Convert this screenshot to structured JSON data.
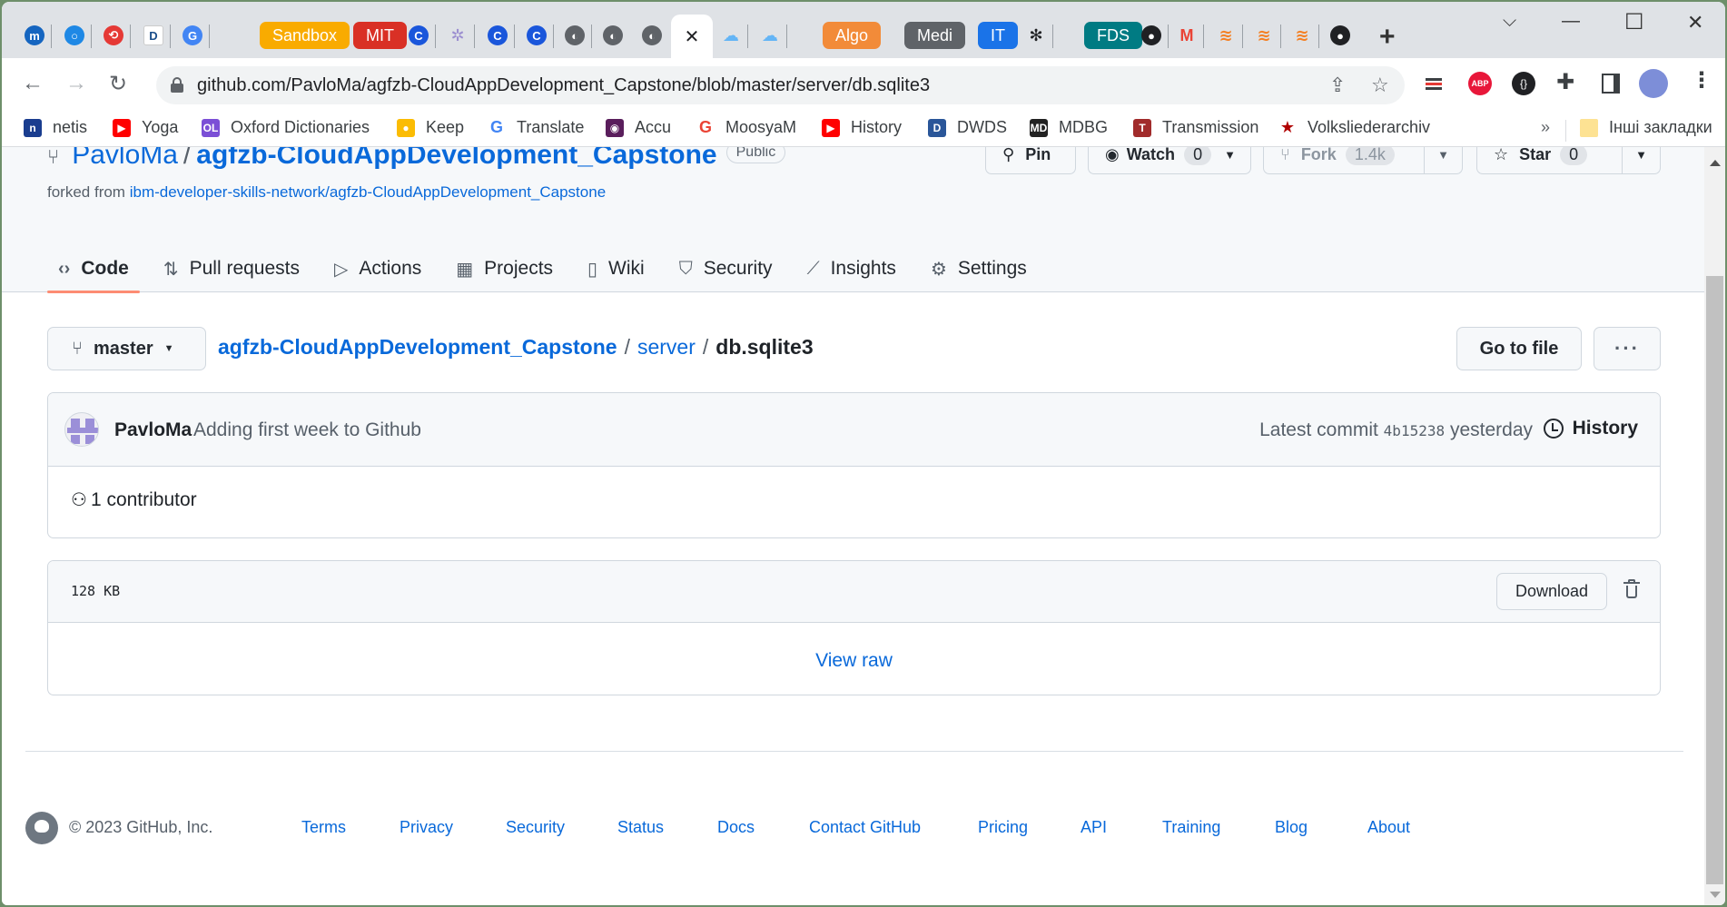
{
  "browser": {
    "tabs": [
      {
        "label": "",
        "icon": "m-logo-icon",
        "color": "#1565c0"
      },
      {
        "label": "",
        "icon": "o-ring-icon",
        "color": "#1e88e5"
      },
      {
        "label": "",
        "icon": "sync-arrows-icon",
        "color": "#e53935"
      },
      {
        "label": "",
        "icon": "d-letter-icon",
        "color": "#1a4e8a"
      },
      {
        "label": "",
        "icon": "google-translate-icon",
        "color": "#4285f4"
      },
      {
        "label": "Sandbox",
        "icon": "",
        "color": "#f9ab00"
      },
      {
        "label": "MIT",
        "icon": "",
        "color": "#d93025"
      },
      {
        "label": "",
        "icon": "c-circle-icon",
        "color": "#1a56db"
      },
      {
        "label": "",
        "icon": "tree-circle-icon",
        "color": "#9c8fd0"
      },
      {
        "label": "",
        "icon": "c-circle-icon",
        "color": "#1a56db"
      },
      {
        "label": "",
        "icon": "c-circle-icon",
        "color": "#1a56db"
      },
      {
        "label": "",
        "icon": "globe-icon",
        "color": "#5f6368"
      },
      {
        "label": "",
        "icon": "globe-icon",
        "color": "#5f6368"
      },
      {
        "label": "",
        "icon": "globe-icon",
        "color": "#5f6368"
      },
      {
        "label": "",
        "icon": "cloud-sun-icon",
        "color": "#64b5f6"
      },
      {
        "label": "",
        "icon": "cloud-sun-icon",
        "color": "#64b5f6"
      },
      {
        "label": "Algo",
        "icon": "",
        "color": "#f28b39"
      },
      {
        "label": "Medi",
        "icon": "",
        "color": "#5f6368"
      },
      {
        "label": "IT",
        "icon": "",
        "color": "#1a73e8"
      },
      {
        "label": "",
        "icon": "bee-icon",
        "color": "#202124"
      },
      {
        "label": "FDS",
        "icon": "",
        "color": "#007b83"
      },
      {
        "label": "",
        "icon": "github-icon",
        "color": "#202124"
      },
      {
        "label": "",
        "icon": "gmail-icon",
        "color": "#ea4335"
      },
      {
        "label": "",
        "icon": "stackoverflow-icon",
        "color": "#f48024"
      },
      {
        "label": "",
        "icon": "stackoverflow-icon",
        "color": "#f48024"
      },
      {
        "label": "",
        "icon": "stackoverflow-icon",
        "color": "#f48024"
      },
      {
        "label": "",
        "icon": "github-icon",
        "color": "#202124"
      }
    ],
    "active_tab_close": "✕",
    "new_tab": "+",
    "url": "github.com/PavloMa/agfzb-CloudAppDevelopment_Capstone/blob/master/server/db.sqlite3",
    "bookmarks": [
      {
        "label": "netis",
        "icon": "n",
        "color": "#1a3d8f"
      },
      {
        "label": "Yoga",
        "icon": "▶",
        "color": "#ff0000"
      },
      {
        "label": "Oxford Dictionaries",
        "icon": "OL",
        "color": "#7b4fd6"
      },
      {
        "label": "Keep",
        "icon": "●",
        "color": "#fbbc04"
      },
      {
        "label": "Translate",
        "icon": "G",
        "color": "#4285f4"
      },
      {
        "label": "Accu",
        "icon": "◉",
        "color": "#5a1e5c"
      },
      {
        "label": "MoosyaM",
        "icon": "G",
        "color": "#ea4335"
      },
      {
        "label": "History",
        "icon": "▶",
        "color": "#ff0000"
      },
      {
        "label": "DWDS",
        "icon": "D",
        "color": "#2a5699"
      },
      {
        "label": "MDBG",
        "icon": "MD",
        "color": "#222222"
      },
      {
        "label": "Transmission",
        "icon": "T",
        "color": "#a12b2b"
      },
      {
        "label": "Volksliederarchiv",
        "icon": "★",
        "color": "#b00000"
      }
    ],
    "bookmarks_overflow": "»",
    "other_bookmarks": "Інші закладки"
  },
  "repo": {
    "owner": "PavloMa",
    "name": "agfzb-CloudAppDevelopment_Capstone",
    "visibility": "Public",
    "forked_from_label": "forked from",
    "forked_from": "ibm-developer-skills-network/agfzb-CloudAppDevelopment_Capstone",
    "pin_label": "Pin",
    "watch_label": "Watch",
    "watch_count": "0",
    "fork_label": "Fork",
    "fork_count": "1.4k",
    "star_label": "Star",
    "star_count": "0"
  },
  "nav": {
    "tabs": [
      {
        "label": "Code",
        "icon": "‹›",
        "active": true
      },
      {
        "label": "Pull requests",
        "icon": "⇅"
      },
      {
        "label": "Actions",
        "icon": "▷"
      },
      {
        "label": "Projects",
        "icon": "▦"
      },
      {
        "label": "Wiki",
        "icon": "▯"
      },
      {
        "label": "Security",
        "icon": "⛉"
      },
      {
        "label": "Insights",
        "icon": "⟋"
      },
      {
        "label": "Settings",
        "icon": "⚙"
      }
    ]
  },
  "file": {
    "branch": "master",
    "path": [
      "agfzb-CloudAppDevelopment_Capstone",
      "server",
      "db.sqlite3"
    ],
    "go_to_file": "Go to file",
    "more": "···",
    "commit": {
      "author": "PavloMa",
      "message": "Adding first week to Github",
      "latest_label": "Latest commit",
      "sha": "4b15238",
      "when": "yesterday",
      "history_label": "History"
    },
    "contributors": "1 contributor",
    "size": "128 KB",
    "download_label": "Download",
    "view_raw": "View raw"
  },
  "footer": {
    "copyright": "© 2023 GitHub, Inc.",
    "links": [
      "Terms",
      "Privacy",
      "Security",
      "Status",
      "Docs",
      "Contact GitHub",
      "Pricing",
      "API",
      "Training",
      "Blog",
      "About"
    ]
  },
  "colors": {
    "link": "#0969da",
    "tab_underline": "#fd8c73"
  }
}
